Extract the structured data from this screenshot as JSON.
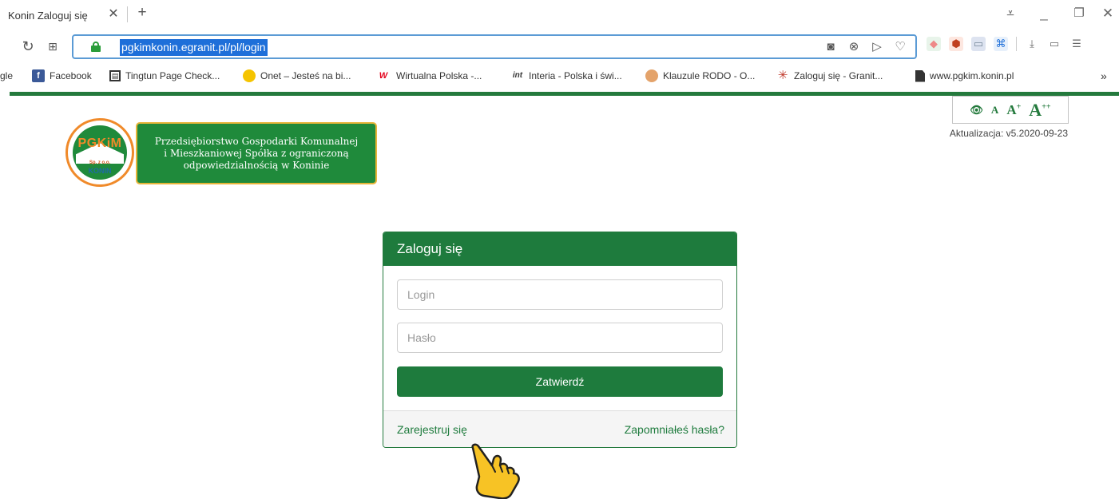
{
  "browser": {
    "tab_title": "Konin Zaloguj się",
    "tab_close": "✕",
    "new_tab": "+",
    "url": "pgkimkonin.egranit.pl/pl/login",
    "bookmarks": [
      {
        "label": "Facebook",
        "icon": "facebook-icon"
      },
      {
        "label": "Tingtun Page Check...",
        "icon": "tingtun-icon"
      },
      {
        "label": "Onet – Jesteś na bi...",
        "icon": "onet-icon"
      },
      {
        "label": "Wirtualna Polska -...",
        "icon": "wp-icon"
      },
      {
        "label": "Interia - Polska i świ...",
        "icon": "interia-icon"
      },
      {
        "label": "Klauzule RODO - O...",
        "icon": "rodo-icon"
      },
      {
        "label": "Zaloguj się - Granit...",
        "icon": "granit-icon"
      },
      {
        "label": "www.pgkim.konin.pl",
        "icon": "document-icon"
      }
    ],
    "bookmark_prefix": "gle",
    "bookmarks_more": "»"
  },
  "header": {
    "logo": {
      "text": "PGKiM",
      "sub": "Sp. z o.o.",
      "city": "KONIN"
    },
    "banner_lines": [
      "Przedsiębiorstwo Gospodarki Komunalnej",
      "i Mieszkaniowej Spółka z ograniczoną",
      "odpowiedzialnością w Koninie"
    ],
    "accessibility": {
      "a_small": "A",
      "a_medium": "A",
      "a_medium_sup": "+",
      "a_large": "A",
      "a_large_sup": "++"
    },
    "update_text": "Aktualizacja: v5.2020-09-23"
  },
  "login": {
    "title": "Zaloguj się",
    "login_placeholder": "Login",
    "password_placeholder": "Hasło",
    "submit_label": "Zatwierdź",
    "register_link": "Zarejestruj się",
    "forgot_link": "Zapomniałeś hasła?"
  },
  "colors": {
    "brand_green": "#1e7b3d",
    "logo_orange": "#f08a2a",
    "url_highlight": "#1e6fd9"
  }
}
